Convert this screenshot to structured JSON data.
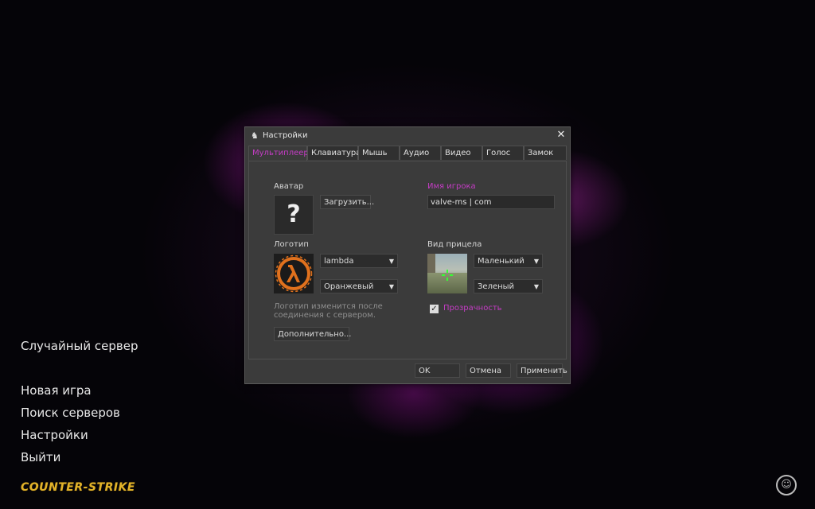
{
  "main_menu": {
    "random_server": "Случайный сервер",
    "new_game": "Новая игра",
    "find_servers": "Поиск серверов",
    "settings": "Настройки",
    "exit": "Выйти"
  },
  "brand": {
    "logo_text": "COUNTER-STRIKE",
    "accent_color": "#e2b32a"
  },
  "dialog": {
    "title": "Настройки",
    "close": "✕",
    "tabs": [
      {
        "label": "Мультиплеер",
        "active": true
      },
      {
        "label": "Клавиатура"
      },
      {
        "label": "Мышь"
      },
      {
        "label": "Аудио"
      },
      {
        "label": "Видео"
      },
      {
        "label": "Голос"
      },
      {
        "label": "Замок"
      }
    ],
    "avatar": {
      "label": "Аватар",
      "placeholder_glyph": "?",
      "load_button": "Загрузить..."
    },
    "player_name": {
      "label": "Имя игрока",
      "value": "valve-ms | com"
    },
    "logo": {
      "label": "Логотип",
      "type_value": "lambda",
      "color_value": "Оранжевый",
      "note": "Логотип изменится после соединения с сервером.",
      "advanced_button": "Дополнительно..."
    },
    "crosshair": {
      "label": "Вид прицела",
      "size_value": "Маленький",
      "color_value": "Зеленый",
      "transparency_label": "Прозрачность",
      "transparency_checked": true
    },
    "footer": {
      "ok": "OK",
      "cancel": "Отмена",
      "apply": "Применить"
    },
    "accent_color": "#c43cc4"
  }
}
